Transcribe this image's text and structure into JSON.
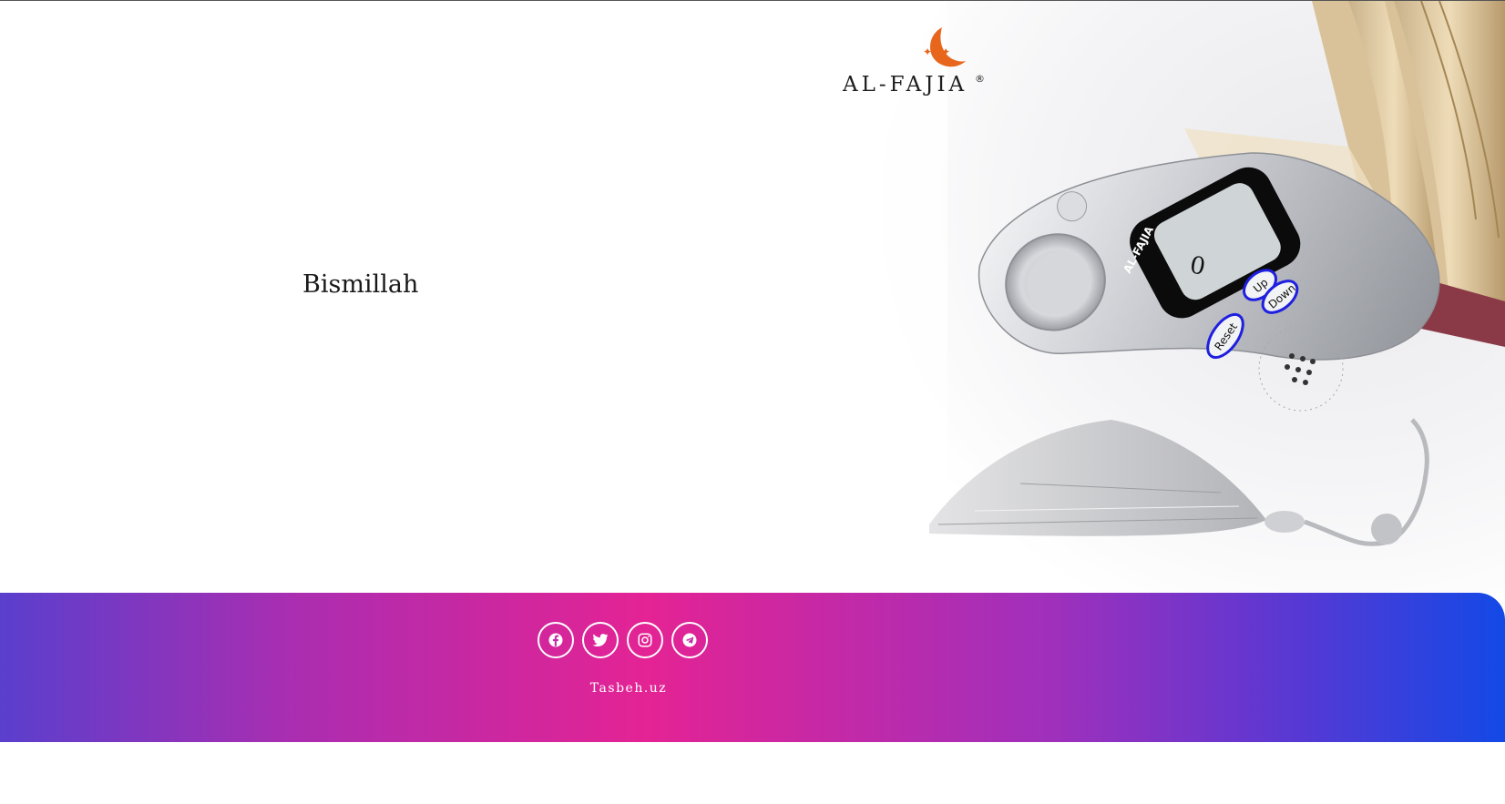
{
  "hero": {
    "greeting": "Bismillah",
    "brand": {
      "name": "AL-FAJIA",
      "mark": "®"
    }
  },
  "counter": {
    "display_value": "0",
    "brand_label": "AL-FAJIA",
    "buttons": {
      "up": "Up",
      "down": "Down",
      "reset": "Reset"
    }
  },
  "footer": {
    "social": [
      {
        "icon": "facebook-icon"
      },
      {
        "icon": "twitter-icon"
      },
      {
        "icon": "instagram-icon"
      },
      {
        "icon": "telegram-icon"
      }
    ],
    "copyright": "Tasbeh.uz"
  },
  "colors": {
    "brand_orange": "#e8661c",
    "button_blue": "#1f1fe0",
    "gradient": [
      "#5a3fcd",
      "#ac2db0",
      "#e42394",
      "#9f30bc",
      "#1349e6"
    ]
  }
}
